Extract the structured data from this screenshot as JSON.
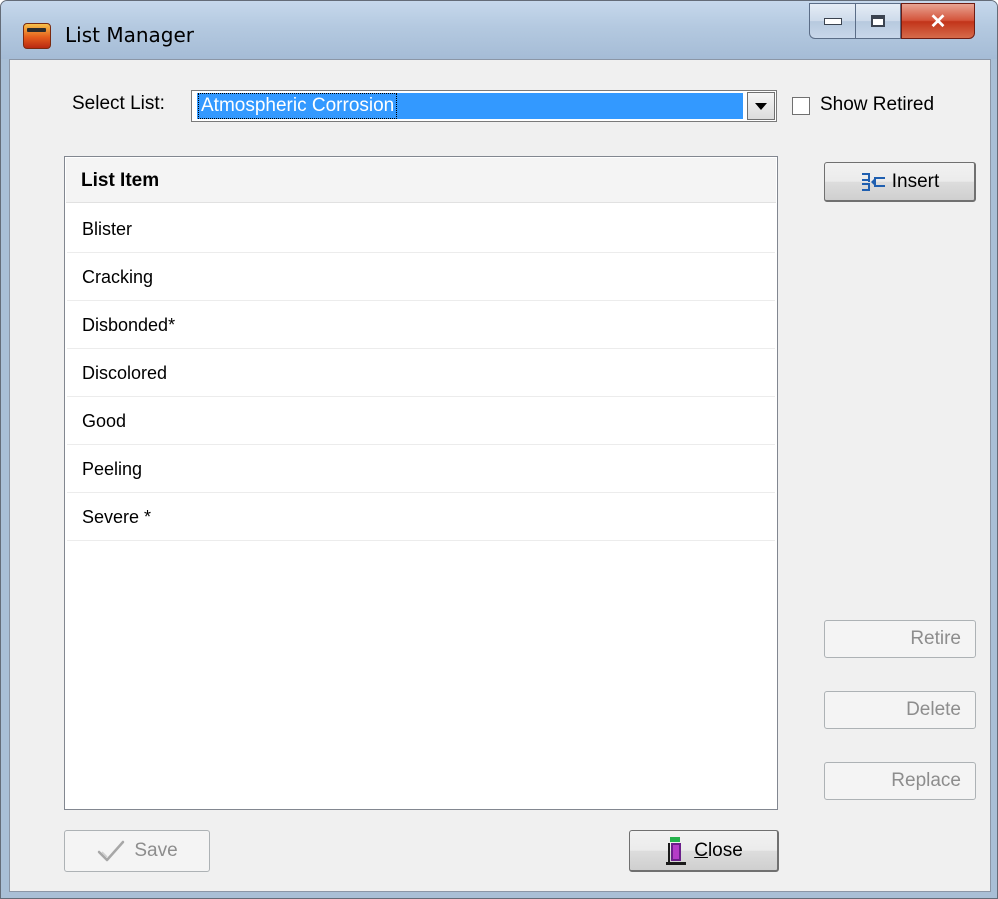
{
  "window": {
    "title": "List Manager"
  },
  "controls": {
    "select_list_label": "Select List:",
    "select_list_value": "Atmospheric Corrosion",
    "show_retired_label": "Show Retired",
    "show_retired_checked": false
  },
  "list": {
    "header": "List Item",
    "items": [
      {
        "label": "Blister"
      },
      {
        "label": "Cracking"
      },
      {
        "label": "Disbonded*"
      },
      {
        "label": "Discolored"
      },
      {
        "label": "Good"
      },
      {
        "label": "Peeling"
      },
      {
        "label": "Severe *"
      }
    ]
  },
  "buttons": {
    "insert": "Insert",
    "retire": "Retire",
    "delete": "Delete",
    "replace": "Replace",
    "save": "Save",
    "close": "Close"
  },
  "icons": {
    "app": "app-icon",
    "insert": "insert-icon",
    "save": "checkmark-icon",
    "close": "door-exit-icon"
  },
  "colors": {
    "selection": "#3399ff",
    "titlebar": "#b4c9e0",
    "close_button": "#c2341a",
    "disabled_text": "#8d8d8d"
  }
}
